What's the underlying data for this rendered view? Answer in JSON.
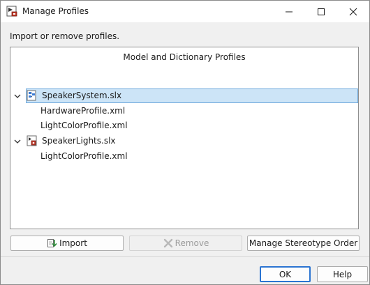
{
  "window": {
    "title": "Manage Profiles",
    "icon": "matlab-dialog-icon",
    "controls": {
      "minimize_icon": "minimize-icon",
      "maximize_icon": "maximize-icon",
      "close_icon": "close-icon"
    }
  },
  "instructions": "Import or remove profiles.",
  "tree": {
    "header": "Model and Dictionary Profiles",
    "nodes": [
      {
        "label": "SpeakerSystem.slx",
        "icon": "simulink-model-icon",
        "expanded": true,
        "selected": true,
        "children": [
          {
            "label": "HardwareProfile.xml"
          },
          {
            "label": "LightColorProfile.xml"
          }
        ]
      },
      {
        "label": "SpeakerLights.slx",
        "icon": "simulink-model-icon",
        "expanded": true,
        "selected": false,
        "children": [
          {
            "label": "LightColorProfile.xml"
          }
        ]
      }
    ]
  },
  "actions": {
    "import_label": "Import",
    "remove_label": "Remove",
    "stereotype_order_label": "Manage Stereotype Order"
  },
  "footer": {
    "ok_label": "OK",
    "help_label": "Help"
  },
  "colors": {
    "selection_fill": "#cce4f7",
    "selection_border": "#6fa9dc",
    "default_button_border": "#2a74d1",
    "disabled_text": "#9c9c9c"
  }
}
